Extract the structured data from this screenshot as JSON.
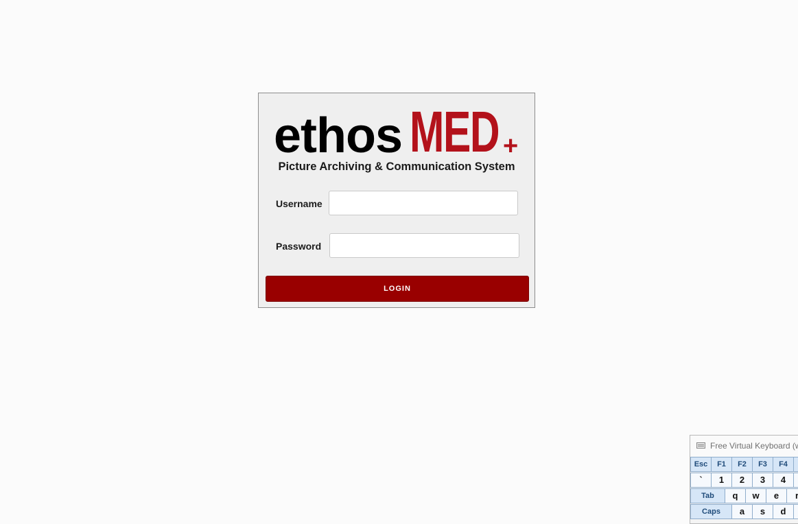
{
  "login": {
    "logo_part1": "ethos",
    "logo_part2": "MED",
    "logo_plus": "+",
    "subtitle": "Picture Archiving & Communication System",
    "username_label": "Username",
    "username_value": "",
    "password_label": "Password",
    "password_value": "",
    "login_button": "LOGIN"
  },
  "keyboard": {
    "title": "Free Virtual Keyboard (w",
    "row1": [
      "Esc",
      "F1",
      "F2",
      "F3",
      "F4",
      ""
    ],
    "row2": [
      "`",
      "1",
      "2",
      "3",
      "4",
      ""
    ],
    "row3": [
      "Tab",
      "q",
      "w",
      "e",
      "r"
    ],
    "row4": [
      "Caps",
      "a",
      "s",
      "d",
      ""
    ]
  },
  "colors": {
    "brand_red": "#b3121b",
    "button_red": "#990000",
    "key_blue": "#d6e6f7"
  }
}
